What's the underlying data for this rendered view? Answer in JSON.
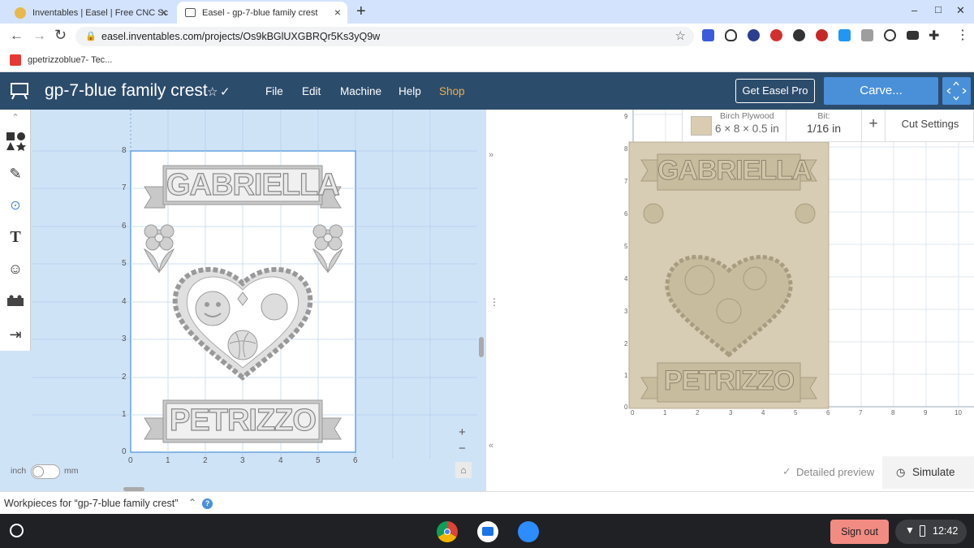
{
  "browser": {
    "tabs": [
      {
        "title": "Inventables | Easel | Free CNC Sc",
        "active": false
      },
      {
        "title": "Easel - gp-7-blue family crest",
        "active": true
      }
    ],
    "new_tab": "+",
    "url": "easel.inventables.com/projects/Os9kBGlUXGBRQr5Ks3yQ9w",
    "bookmark": "gpetrizzoblue7- Tec...",
    "window_controls": [
      "–",
      "□",
      "✕"
    ]
  },
  "app": {
    "title": "gp-7-blue family crest",
    "menu": [
      "File",
      "Edit",
      "Machine",
      "Help",
      "Shop"
    ],
    "get_pro": "Get Easel Pro",
    "carve": "Carve...",
    "colors": {
      "header": "#2c4c6c",
      "shop": "#f0b045",
      "carve": "#4a90d9",
      "canvas": "#cfe3f7"
    }
  },
  "tools": [
    "shapes-icon",
    "pen-icon",
    "target-icon",
    "text-icon",
    "smiley-icon",
    "apps-icon",
    "import-icon"
  ],
  "design": {
    "top_name": "GABRIELLA",
    "bottom_name": "PETRIZZO",
    "y_ticks": [
      "8",
      "7",
      "6",
      "5",
      "4",
      "3",
      "2",
      "1",
      "0"
    ],
    "x_ticks": [
      "0",
      "1",
      "2",
      "3",
      "4",
      "5",
      "6"
    ],
    "unit_left": "inch",
    "unit_right": "mm",
    "zoom_in": "+",
    "zoom_out": "−"
  },
  "material": {
    "name": "Birch Plywood",
    "size": "6 × 8 × 0.5 in",
    "bit_label": "Bit:",
    "bit": "1/16 in",
    "add": "+",
    "cut_settings": "Cut Settings"
  },
  "preview": {
    "top_name": "GABRIELLA",
    "bottom_name": "PETRIZZO",
    "y_ticks": [
      "9",
      "8",
      "7",
      "6",
      "5",
      "4",
      "3",
      "2",
      "1",
      "0"
    ],
    "x_ticks": [
      "0",
      "1",
      "2",
      "3",
      "4",
      "5",
      "6",
      "7",
      "8",
      "9",
      "10"
    ],
    "detailed_preview": "Detailed preview",
    "simulate": "Simulate"
  },
  "workpieces": "Workpieces for “gp-7-blue family crest”",
  "shelf": {
    "sign_out": "Sign out",
    "time": "12:42"
  }
}
